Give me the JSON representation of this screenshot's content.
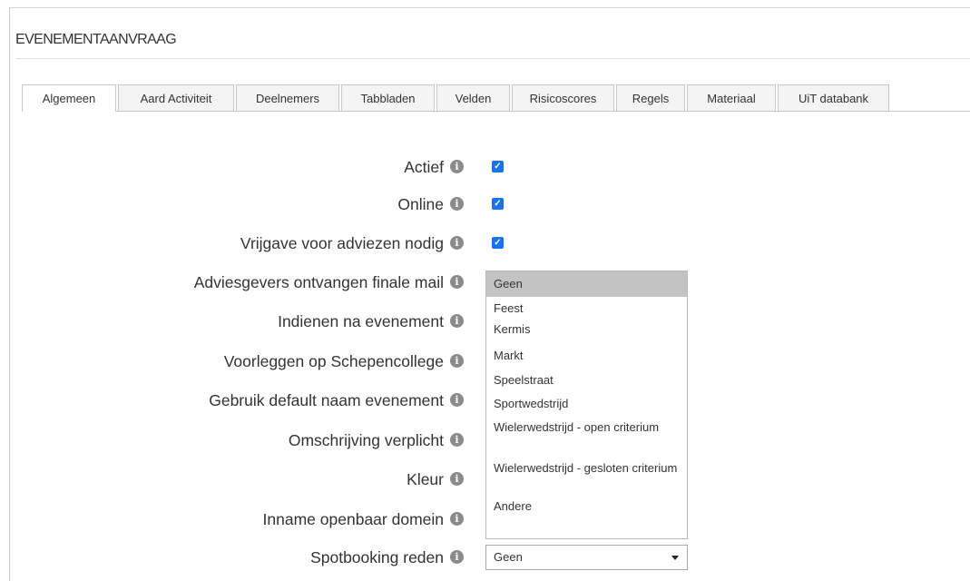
{
  "panel": {
    "title": "EVENEMENTAANVRAAG"
  },
  "tabs": [
    {
      "label": "Algemeen",
      "active": true
    },
    {
      "label": "Aard Activiteit"
    },
    {
      "label": "Deelnemers"
    },
    {
      "label": "Tabbladen"
    },
    {
      "label": "Velden"
    },
    {
      "label": "Risicoscores"
    },
    {
      "label": "Regels"
    },
    {
      "label": "Materiaal"
    },
    {
      "label": "UiT databank"
    }
  ],
  "fields": [
    {
      "label": "Actief",
      "checked": true
    },
    {
      "label": "Online",
      "checked": true
    },
    {
      "label": "Vrijgave voor adviezen nodig",
      "checked": true
    },
    {
      "label": "Adviesgevers ontvangen finale mail"
    },
    {
      "label": "Indienen na evenement"
    },
    {
      "label": "Voorleggen op Schepencollege"
    },
    {
      "label": "Gebruik default naam evenement"
    },
    {
      "label": "Omschrijving verplicht"
    },
    {
      "label": "Kleur"
    },
    {
      "label": "Inname openbaar domein"
    },
    {
      "label": "Spotbooking reden"
    }
  ],
  "info_icon": {
    "glyph": "i",
    "name": "info-icon"
  },
  "checkbox_glyph": "✓",
  "dropdown": {
    "options": [
      "Geen",
      "Feest",
      "Kermis",
      "Markt",
      "Speelstraat",
      "Sportwedstrijd",
      "Wielerwedstrijd - open criterium",
      "Wielerwedstrijd - gesloten criterium",
      "Andere"
    ],
    "highlighted": "Geen"
  },
  "spotbooking_select": {
    "value": "Geen"
  },
  "colors": {
    "checkbox": "#1a73e8",
    "highlight": "#c3c3c3",
    "border": "#c8c8c8"
  }
}
